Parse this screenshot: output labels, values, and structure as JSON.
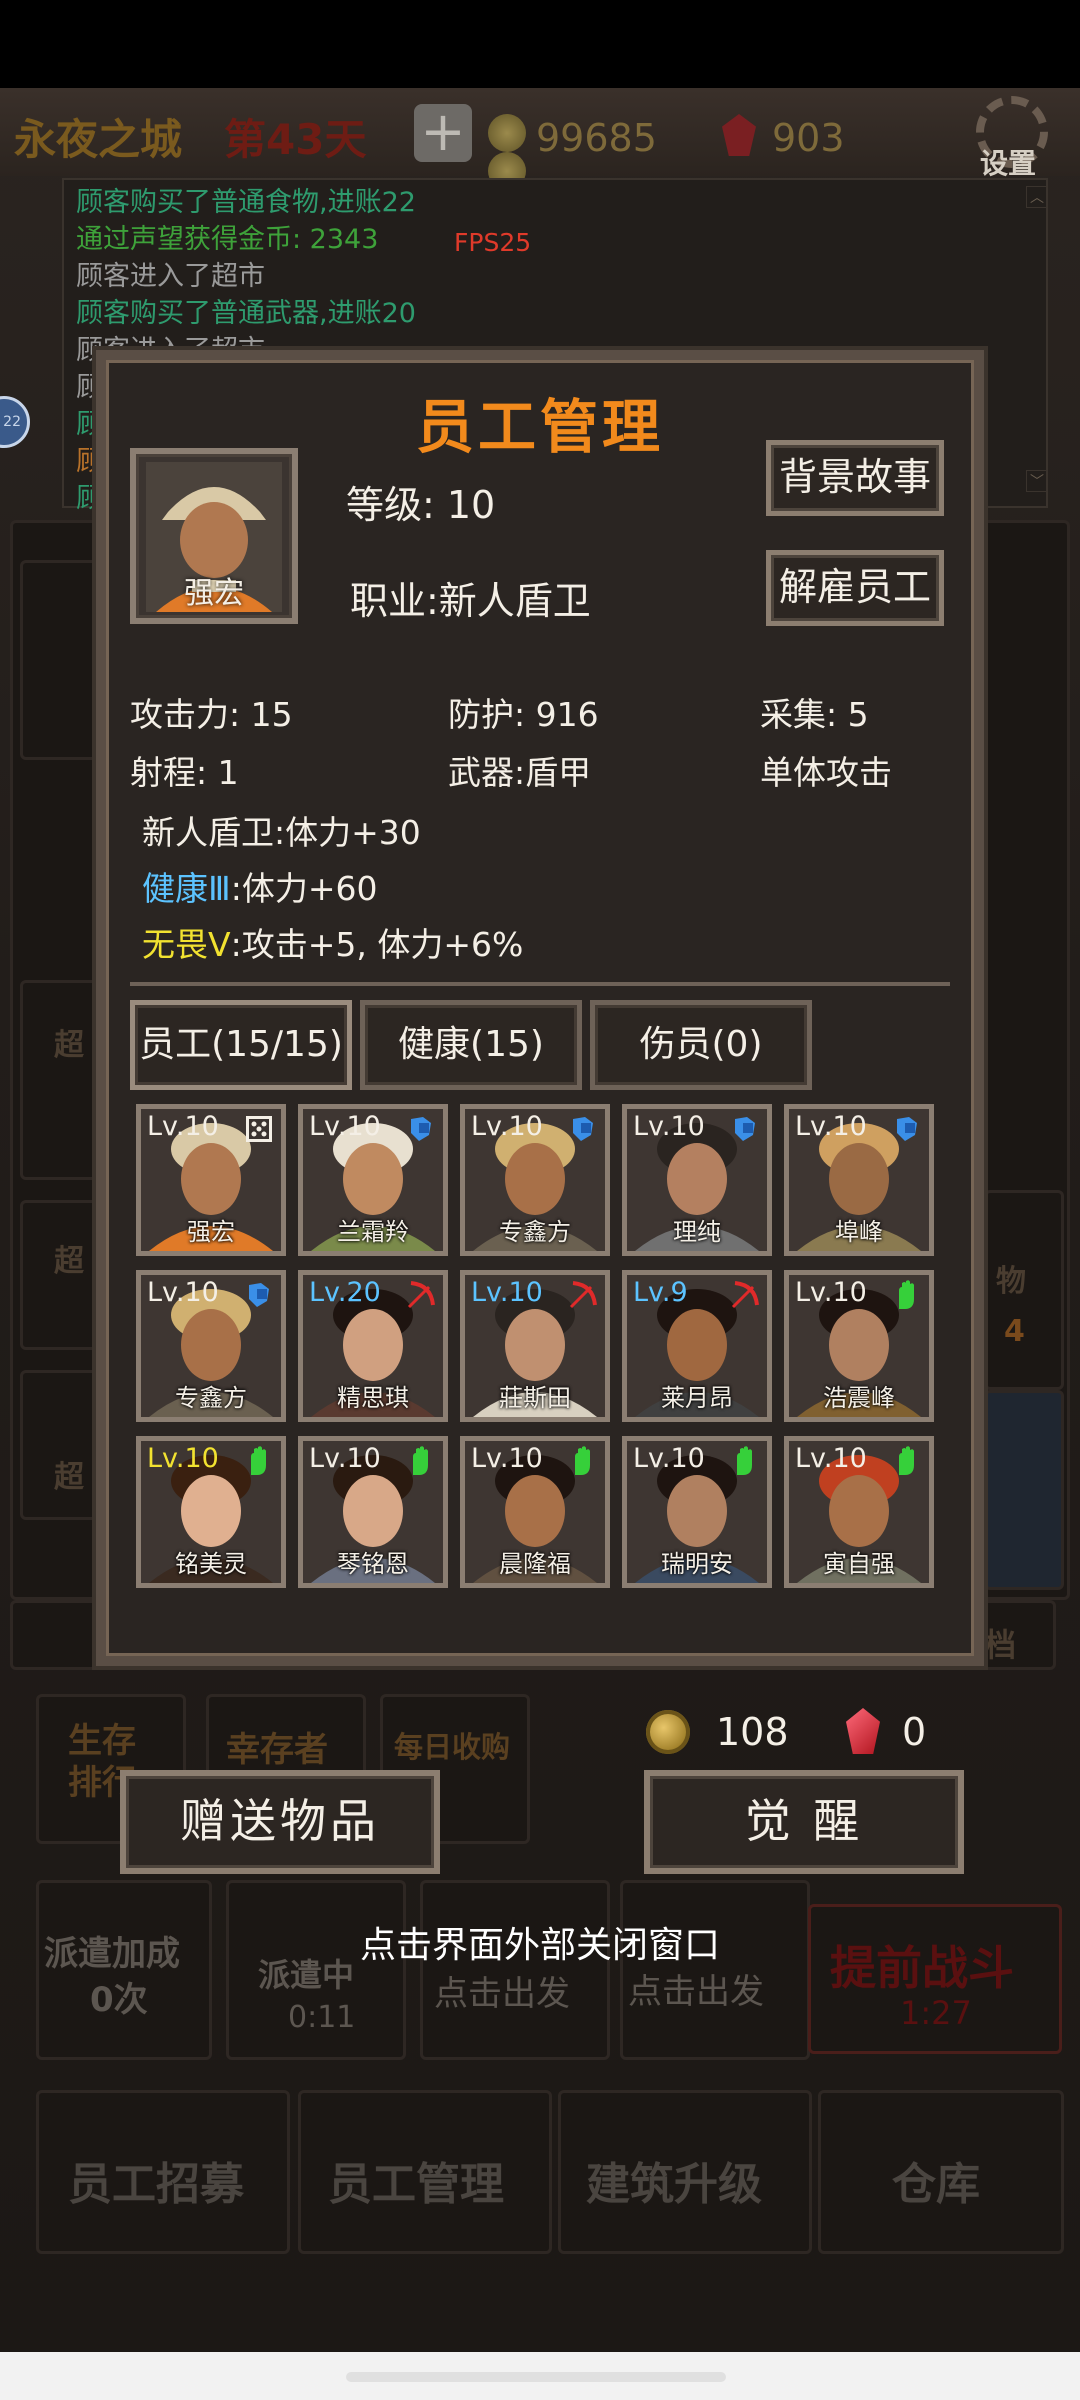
{
  "top": {
    "city": "永夜之城",
    "day": "第43天",
    "gold": "99685",
    "gems": "903",
    "settings_label": "设置"
  },
  "log": {
    "lines": [
      {
        "text": "顾客购买了普通食物,进账22",
        "color": "#2e9b6e"
      },
      {
        "text": "通过声望获得金币: 2343",
        "color": "#3ea23a"
      },
      {
        "text": "顾客进入了超市",
        "color": "#9a9a9a"
      },
      {
        "text": "顾客购买了普通武器,进账20",
        "color": "#2e9b6e"
      },
      {
        "text": "顾客进入了超市",
        "color": "#9a9a9a"
      },
      {
        "text": "顾",
        "color": "#9a9a9a"
      },
      {
        "text": "顾",
        "color": "#2e9b6e"
      },
      {
        "text": "顾",
        "color": "#b8722a"
      },
      {
        "text": "顾",
        "color": "#2e9b6e"
      }
    ],
    "fps": "FPS25",
    "bubble": "22"
  },
  "modal": {
    "title": "员工管理",
    "selected": {
      "name": "强宏",
      "level_label": "等级: 10",
      "job_label": "职业:新人盾卫"
    },
    "buttons": {
      "backstory": "背景故事",
      "fire": "解雇员工"
    },
    "stats": {
      "attack": "攻击力: 15",
      "defense": "防护: 916",
      "gather": "采集: 5",
      "range": "射程: 1",
      "weapon": "武器:盾甲",
      "target": "单体攻击"
    },
    "traits": [
      {
        "label": "新人盾卫",
        "effect": ":体力+30",
        "color": "#f4efe6"
      },
      {
        "label": "健康Ⅲ",
        "effect": ":体力+60",
        "color": "#5cc3ff"
      },
      {
        "label": "无畏Ⅴ",
        "effect": ":攻击+5, 体力+6%",
        "color": "#f2e230"
      }
    ],
    "tabs": {
      "staff": "员工(15/15)",
      "healthy": "健康(15)",
      "injured": "伤员(0)"
    },
    "staff": [
      {
        "lv": "Lv.10",
        "name": "强宏",
        "role": "dice",
        "lvcolor": "#f4efe6"
      },
      {
        "lv": "Lv.10",
        "name": "兰霜羚",
        "role": "shield",
        "lvcolor": "#f4efe6"
      },
      {
        "lv": "Lv.10",
        "name": "专鑫方",
        "role": "shield",
        "lvcolor": "#f4efe6"
      },
      {
        "lv": "Lv.10",
        "name": "理纯",
        "role": "shield",
        "lvcolor": "#f4efe6"
      },
      {
        "lv": "Lv.10",
        "name": "埠峰",
        "role": "shield",
        "lvcolor": "#f4efe6"
      },
      {
        "lv": "Lv.10",
        "name": "专鑫方",
        "role": "shield",
        "lvcolor": "#f4efe6"
      },
      {
        "lv": "Lv.20",
        "name": "精思琪",
        "role": "bow",
        "lvcolor": "#5cc3ff"
      },
      {
        "lv": "Lv.10",
        "name": "莊斯田",
        "role": "bow",
        "lvcolor": "#5cc3ff"
      },
      {
        "lv": "Lv.9",
        "name": "莱月昂",
        "role": "bow",
        "lvcolor": "#5cc3ff"
      },
      {
        "lv": "Lv.10",
        "name": "浩震峰",
        "role": "hand",
        "lvcolor": "#f4efe6"
      },
      {
        "lv": "Lv.10",
        "name": "铭美灵",
        "role": "hand",
        "lvcolor": "#f2e230"
      },
      {
        "lv": "Lv.10",
        "name": "琴铭恩",
        "role": "hand",
        "lvcolor": "#f4efe6"
      },
      {
        "lv": "Lv.10",
        "name": "晨隆福",
        "role": "hand",
        "lvcolor": "#f4efe6"
      },
      {
        "lv": "Lv.10",
        "name": "瑞明安",
        "role": "hand",
        "lvcolor": "#f4efe6"
      },
      {
        "lv": "Lv.10",
        "name": "寅自强",
        "role": "hand",
        "lvcolor": "#f4efe6"
      }
    ]
  },
  "resources": {
    "coins": "108",
    "gems": "0"
  },
  "actions": {
    "gift": "赠送物品",
    "awaken": "觉 醒"
  },
  "close_hint": "点击界面外部关闭窗口",
  "background": {
    "rank_title": "生存排行",
    "survivor": "幸存者",
    "daily": "每日收购",
    "dispatch_bonus": "派遣加成",
    "dispatch_count": "0次",
    "dispatching": "派遣中",
    "dispatch_timer": "0:11",
    "go1": "点击出发",
    "go2": "点击出发",
    "battle": "提前战斗",
    "battle_timer": "1:27",
    "nav_recruit": "员工招募",
    "nav_manage": "员工管理",
    "nav_upgrade": "建筑升级",
    "nav_warehouse": "仓库",
    "side_item": "物",
    "side_num": "4",
    "side_gear": "档",
    "left_super1": "超",
    "left_super2": "超",
    "left_super3": "超"
  }
}
